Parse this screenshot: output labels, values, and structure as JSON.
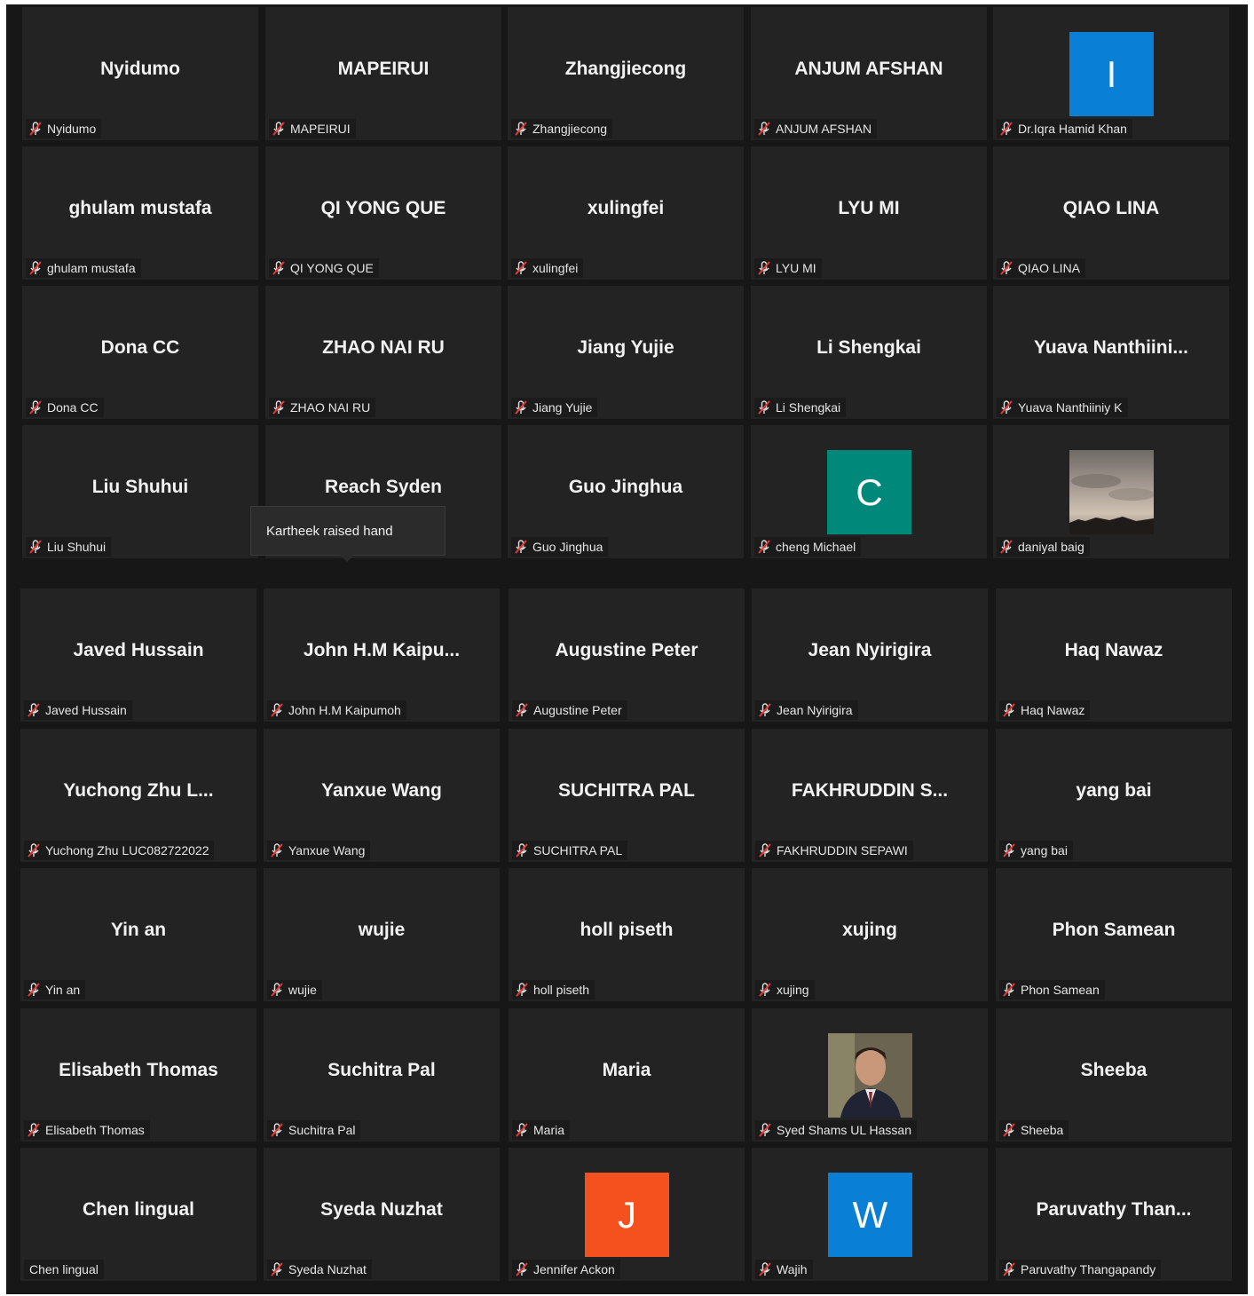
{
  "tooltip": {
    "text": "Kartheek raised hand"
  },
  "tiles": [
    {
      "big": "Nyidumo",
      "tag": "Nyidumo",
      "muted": true
    },
    {
      "big": "MAPEIRUI",
      "tag": "MAPEIRUI",
      "muted": true
    },
    {
      "big": "Zhangjiecong",
      "tag": "Zhangjiecong",
      "muted": true
    },
    {
      "big": "ANJUM AFSHAN",
      "tag": "ANJUM AFSHAN",
      "muted": true
    },
    {
      "big": "",
      "avatar_letter": "I",
      "avatar_color": "#0a7fd6",
      "tag": "Dr.Iqra Hamid Khan",
      "muted": true
    },
    {
      "big": "ghulam mustafa",
      "tag": "ghulam mustafa",
      "muted": true
    },
    {
      "big": "QI YONG QUE",
      "tag": "QI YONG QUE",
      "muted": true
    },
    {
      "big": "xulingfei",
      "tag": "xulingfei",
      "muted": true
    },
    {
      "big": "LYU MI",
      "tag": "LYU MI",
      "muted": true
    },
    {
      "big": "QIAO LINA",
      "tag": "QIAO LINA",
      "muted": true
    },
    {
      "big": "Dona CC",
      "tag": "Dona CC",
      "muted": true
    },
    {
      "big": "ZHAO NAI RU",
      "tag": "ZHAO NAI RU",
      "muted": true
    },
    {
      "big": "Jiang Yujie",
      "tag": "Jiang Yujie",
      "muted": true
    },
    {
      "big": "Li Shengkai",
      "tag": "Li Shengkai",
      "muted": true
    },
    {
      "big": "Yuava  Nanthiini...",
      "tag": "Yuava Nanthiiniy K",
      "muted": true
    },
    {
      "big": "Liu Shuhui",
      "tag": "Liu Shuhui",
      "muted": true
    },
    {
      "big": "Reach Syden",
      "tag": "",
      "muted": false
    },
    {
      "big": "Guo Jinghua",
      "tag": "Guo Jinghua",
      "muted": true
    },
    {
      "big": "",
      "avatar_letter": "C",
      "avatar_color": "#00897b",
      "tag": "cheng Michael",
      "muted": true
    },
    {
      "big": "",
      "photo": "sky",
      "tag": "daniyal baig",
      "muted": true
    },
    {
      "big": "Javed Hussain",
      "tag": "Javed Hussain",
      "muted": true
    },
    {
      "big": "John  H.M  Kaipu...",
      "tag": "John H.M Kaipumoh",
      "muted": true
    },
    {
      "big": "Augustine Peter",
      "tag": "Augustine Peter",
      "muted": true
    },
    {
      "big": "Jean Nyirigira",
      "tag": "Jean Nyirigira",
      "muted": true
    },
    {
      "big": "Haq Nawaz",
      "tag": "Haq Nawaz",
      "muted": true
    },
    {
      "big": "Yuchong Zhu L...",
      "tag": "Yuchong Zhu LUC082722022",
      "muted": true
    },
    {
      "big": "Yanxue Wang",
      "tag": "Yanxue Wang",
      "muted": true
    },
    {
      "big": "SUCHITRA PAL",
      "tag": "SUCHITRA PAL",
      "muted": true
    },
    {
      "big": "FAKHRUDDIN  S...",
      "tag": "FAKHRUDDIN SEPAWI",
      "muted": true
    },
    {
      "big": "yang bai",
      "tag": "yang bai",
      "muted": true
    },
    {
      "big": "Yin an",
      "tag": "Yin an",
      "muted": true
    },
    {
      "big": "wujie",
      "tag": "wujie",
      "muted": true
    },
    {
      "big": "holl piseth",
      "tag": "holl piseth",
      "muted": true
    },
    {
      "big": "xujing",
      "tag": "xujing",
      "muted": true
    },
    {
      "big": "Phon Samean",
      "tag": "Phon Samean",
      "muted": true
    },
    {
      "big": "Elisabeth Thomas",
      "tag": "Elisabeth Thomas",
      "muted": true
    },
    {
      "big": "Suchitra Pal",
      "tag": "Suchitra Pal",
      "muted": true
    },
    {
      "big": "Maria",
      "tag": "Maria",
      "muted": true
    },
    {
      "big": "",
      "photo": "person",
      "tag": "Syed Shams UL Hassan",
      "muted": true
    },
    {
      "big": "Sheeba",
      "tag": "Sheeba",
      "muted": true
    },
    {
      "big": "Chen lingual",
      "tag": "Chen lingual",
      "muted": false
    },
    {
      "big": "Syeda Nuzhat",
      "tag": "Syeda Nuzhat",
      "muted": true
    },
    {
      "big": "",
      "avatar_letter": "J",
      "avatar_color": "#f4511e",
      "tag": "Jennifer Ackon",
      "muted": true
    },
    {
      "big": "",
      "avatar_letter": "W",
      "avatar_color": "#0a7fd6",
      "tag": "Wajih",
      "muted": true
    },
    {
      "big": "Paruvathy  Than...",
      "tag": "Paruvathy Thangapandy",
      "muted": true
    }
  ]
}
